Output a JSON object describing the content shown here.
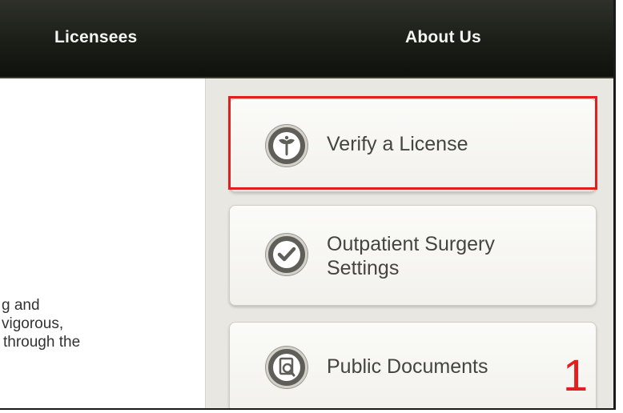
{
  "topnav": {
    "licensees": "Licensees",
    "about_us": "About Us"
  },
  "intro": {
    "line1": "g and",
    "line2": "vigorous,",
    "line3": "through the"
  },
  "sidebar": {
    "items": [
      {
        "label": "Verify a License",
        "icon": "caduceus-icon"
      },
      {
        "label": "Outpatient Surgery Settings",
        "icon": "checkmark-icon"
      },
      {
        "label": "Public Documents",
        "icon": "document-search-icon"
      }
    ]
  },
  "annotation": {
    "step": "1",
    "color": "#e02020"
  }
}
